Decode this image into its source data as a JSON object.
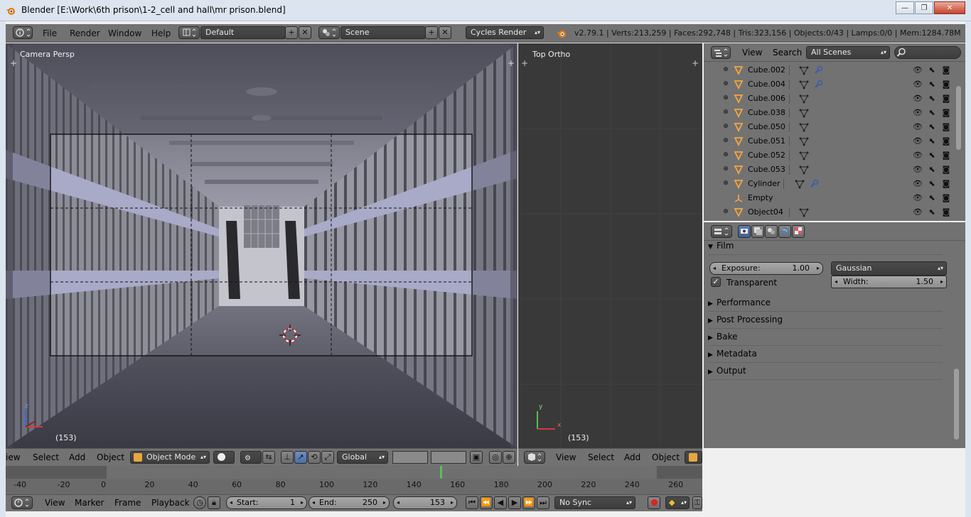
{
  "window": {
    "title": "Blender [E:\\Work\\6th prison\\1-2_cell and hall\\mr prison.blend]",
    "minimize": "—",
    "maximize": "❐",
    "close": "✕"
  },
  "header": {
    "menus": [
      "File",
      "Render",
      "Window",
      "Help"
    ],
    "layout": "Default",
    "scene": "Scene",
    "engine": "Cycles Render",
    "stats": "v2.79.1 | Verts:213,259 | Faces:292,748 | Tris:323,156 | Objects:0/43 | Lamps:0/0 | Mem:1284.78M"
  },
  "viewport_left": {
    "label": "Camera Persp",
    "frame": "(153)"
  },
  "viewport_right": {
    "label": "Top Ortho",
    "frame": "(153)"
  },
  "axis": {
    "x": "x",
    "y": "y",
    "z": "z"
  },
  "outliner": {
    "view": "View",
    "search": "Search",
    "scope": "All Scenes",
    "items": [
      {
        "name": "Cube.002",
        "modifier": true
      },
      {
        "name": "Cube.004",
        "modifier": true
      },
      {
        "name": "Cube.006",
        "modifier": false
      },
      {
        "name": "Cube.038",
        "modifier": false
      },
      {
        "name": "Cube.050",
        "modifier": false
      },
      {
        "name": "Cube.051",
        "modifier": false
      },
      {
        "name": "Cube.052",
        "modifier": false
      },
      {
        "name": "Cube.053",
        "modifier": false
      },
      {
        "name": "Cylinder",
        "modifier": true
      },
      {
        "name": "Empty",
        "modifier": false
      },
      {
        "name": "Object04",
        "modifier": false
      }
    ]
  },
  "properties": {
    "film": "Film",
    "exposure_label": "Exposure:",
    "exposure_value": "1.00",
    "filter": "Gaussian",
    "transparent": "Transparent",
    "width_label": "Width:",
    "width_value": "1.50",
    "panels": [
      "Performance",
      "Post Processing",
      "Bake",
      "Metadata",
      "Output"
    ]
  },
  "vp_header_left": {
    "menus": [
      "iew",
      "Select",
      "Add",
      "Object"
    ],
    "mode": "Object Mode",
    "orientation": "Global"
  },
  "vp_header_right": {
    "menus": [
      "View",
      "Select",
      "Add",
      "Object"
    ]
  },
  "timeline": {
    "ticks": [
      "-40",
      "-20",
      "0",
      "20",
      "40",
      "60",
      "80",
      "100",
      "120",
      "140",
      "160",
      "180",
      "200",
      "220",
      "240",
      "260"
    ],
    "current_frame": 153,
    "menus": [
      "View",
      "Marker",
      "Frame",
      "Playback"
    ],
    "start_label": "Start:",
    "start": "1",
    "end_label": "End:",
    "end": "250",
    "frame": "153",
    "sync": "No Sync"
  }
}
